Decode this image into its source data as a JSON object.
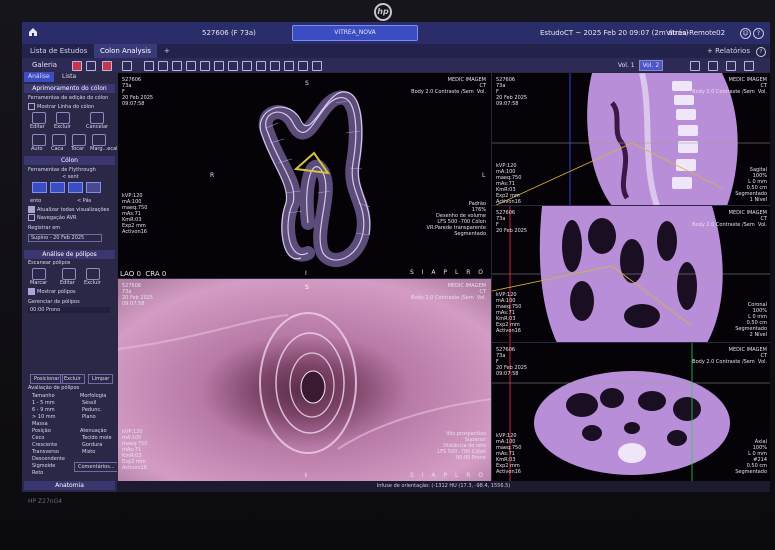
{
  "monitor": {
    "brand": "HP Z27nG4"
  },
  "topbar": {
    "patient_id": "527606 (F 73a)",
    "center_pill": "VITREA_NOVA",
    "study": "EstudoCT ~ 2025 Feb 20 09:07 (2m atrás)",
    "remote": "Vitrea-Remote02"
  },
  "tabs": {
    "items": [
      "Lista de Estudos",
      "Colon Analysis"
    ],
    "add": "+",
    "more": "+ Relatórios"
  },
  "toolbar": {
    "gallery": "Galeria",
    "vol_label": "Vol. 1",
    "vol_btn": "Vol. 2"
  },
  "left": {
    "tab_analise": "Análise",
    "tab_lista": "Lista",
    "sec_aprim": "Aprimoramento do cólon",
    "tools_edit": "Ferramentas de edição do cólon",
    "mostrar_linha": "Mostrar Linha do cólon",
    "edit_btns": [
      "Editar",
      "Excluir",
      "Cancelar"
    ],
    "auto_btns": [
      "Auto",
      "Caca",
      "Tocar",
      "Marg...ecal"
    ],
    "sec_colon": "Cólon",
    "flythrough": "Ferramentas de Flythrough",
    "sentido": "< sent",
    "fps": "< Pás",
    "fps2": "ento",
    "chk1": "Atualizar todas visualizações",
    "chk2": "Navegação AVR",
    "registrar": "Registrar em",
    "supino": "Supino - 20 Feb 2025",
    "sec_polipos": "Análise de pólipos",
    "escanear": "Escanear pólipos",
    "pol_btns": [
      "Marcar",
      "Editar",
      "Excluir"
    ],
    "mostrar_pol": "Mostrar pólipos",
    "gerenciar": "Gerenciar de pólipos",
    "gerenciar_sub": "00:00 Prono",
    "bottom_btns": [
      "Posicionar",
      "Excluir",
      "Limpar"
    ],
    "avaliacao": "Avaliação de pólipos",
    "tamanho": "Tamanho",
    "morfologia": "Morfologia",
    "tam_opts": [
      "1 - 5 mm",
      "6 - 9 mm",
      "> 10 mm",
      "Massa"
    ],
    "morf_opts": [
      "Séssil",
      "Pedunc.",
      "Plano"
    ],
    "posicao": "Posição",
    "atenuacao": "Atenuação",
    "pos_opts": [
      "Ceco",
      "Crescente",
      "Transverso",
      "Descendente",
      "Sigmoide",
      "Reto"
    ],
    "aten_opts": [
      "Tecido mole",
      "Gordura",
      "Misto"
    ],
    "comentario": "Comentários...",
    "anatomia": "Anatomia"
  },
  "vp3d": {
    "tl": "527606\n73a\nF\n20 Feb 2025\n09:07:58",
    "tr": "MEDIC IMAGEM\nCT\nBody 2.0 Contraste /Sem  Vol.",
    "bl": "kVP:120\nmA:100\nmaeq:750\nmAs:71\nKmR:03\nExp2 mm\nActivon16",
    "br": "Padrão\n176%\nDesenho de volume\nLFS 500 -700 Cólon\nVR:Parede transparente\nSegmentado",
    "lao": "LAO 0  CRA 0",
    "siap": "S I A P L R O"
  },
  "vpendo": {
    "tl": "527606\n73a\n20 Feb 2025\n09:07:58",
    "tr": "MEDIC IMAGEM\nCT\nBody 2.0 Contraste /Sem  Vol.",
    "bl": "kVP:120\nmA:100\nmaeq:750\nmAs:71\nKmR:03\nExp2 mm\nActivon16",
    "br": "Vôo prospectivo\nSuperior\nDistância do reto\nLFS 500 -700 Cólon\n00:00 Prono",
    "siap": "S I A P L R O"
  },
  "vpsag": {
    "tl": "527606\n73a\nF\n20 Feb 2025\n09:07:58",
    "tr": "MEDIC IMAGEM\nCT\nBody 2.0 Contraste /Sem  Vol.",
    "bl": "kVP:120\nmA:100\nmaeq:750\nmAs:71\nKmR:03\nExp2 mm\nActivon16",
    "br": "Sagital\n100%\nL 0 mm\n0.50 cm\nSegmentado\n1 Nível"
  },
  "vpcor": {
    "tl": "527606\n73a\nF\n20 Feb 2025",
    "tr": "MEDIC IMAGEM\nCT\nBody 2.0 Contraste /Sem  Vol.",
    "bl": "kVP:120\nmA:100\nmaeq:750\nmAs:71\nKmR:03\nExp2 mm\nActivon16",
    "br": "Coronal\n100%\nL 0 mm\n0.50 cm\nSegmentado\n2 Nível"
  },
  "vpax": {
    "tl": "527606\n73a\nF\n20 Feb 2025\n09:07:58",
    "tr": "MEDIC IMAGEM\nCT\nBody 2.0 Contraste /Sem  Vol.",
    "bl": "kVP:120\nmA:100\nmaeq:750\nmAs:71\nKmR:03\nExp2 mm\nActivon16",
    "br": "Axial\n100%\nL 0 mm\n#214\n0.50 cm\nSegmentado"
  },
  "status": "Infuse de orientação: (-1312 HU (17.3, -98.4, 1556.5)"
}
